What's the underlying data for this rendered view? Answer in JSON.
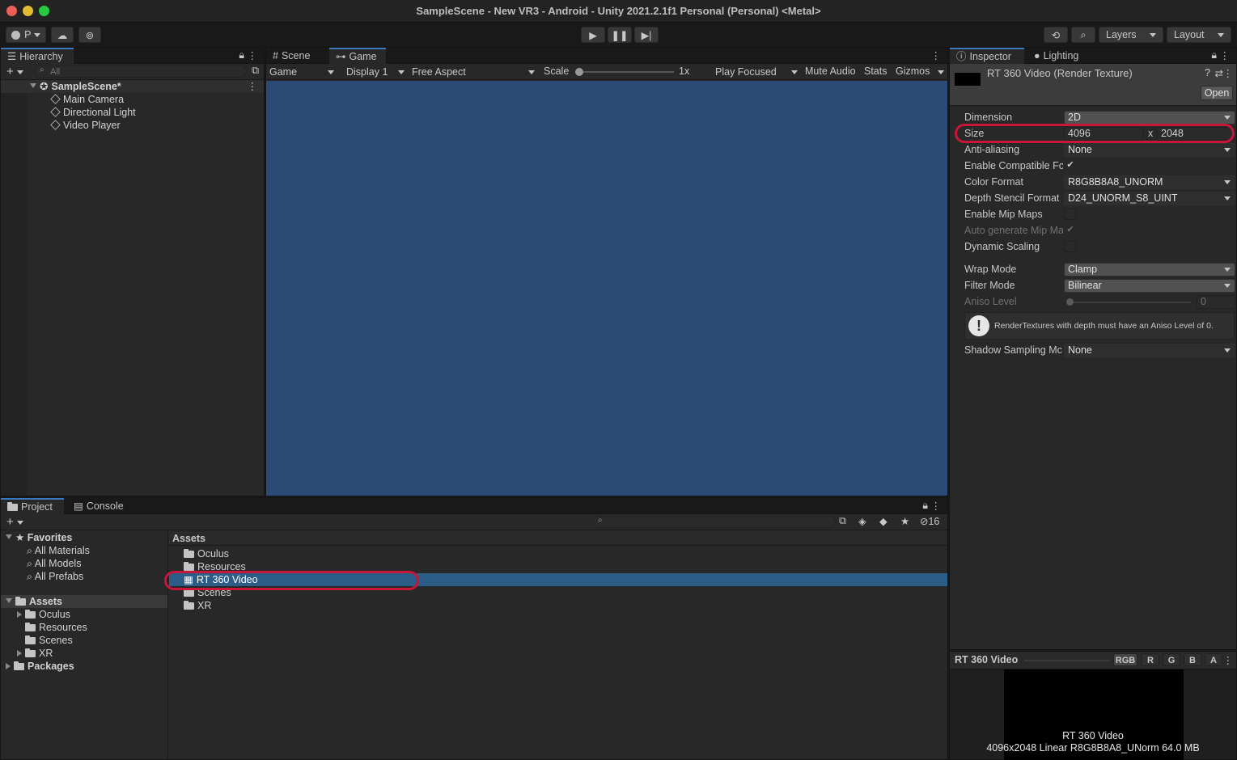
{
  "window": {
    "title": "SampleScene - New VR3 - Android - Unity 2021.2.1f1 Personal (Personal) <Metal>"
  },
  "toolbar": {
    "account": "P",
    "layers": "Layers",
    "layout": "Layout"
  },
  "hierarchy": {
    "tab": "Hierarchy",
    "search_placeholder": "All",
    "scene": "SampleScene*",
    "items": [
      "Main Camera",
      "Directional Light",
      "Video Player"
    ]
  },
  "game": {
    "tabs": [
      "Scene",
      "Game"
    ],
    "display_mode": "Game",
    "display": "Display 1",
    "aspect": "Free Aspect",
    "scale_label": "Scale",
    "scale_value": "1x",
    "play_focused": "Play Focused",
    "mute": "Mute Audio",
    "stats": "Stats",
    "gizmos": "Gizmos",
    "bg_color": "#2b4a76"
  },
  "inspector": {
    "tabs": [
      "Inspector",
      "Lighting"
    ],
    "asset_title": "RT 360 Video (Render Texture)",
    "open_button": "Open",
    "fields": {
      "dimension": {
        "label": "Dimension",
        "value": "2D"
      },
      "size": {
        "label": "Size",
        "width": "4096",
        "x": "x",
        "height": "2048"
      },
      "anti_aliasing": {
        "label": "Anti-aliasing",
        "value": "None"
      },
      "compatible": {
        "label": "Enable Compatible Fc",
        "checked": true
      },
      "color_format": {
        "label": "Color Format",
        "value": "R8G8B8A8_UNORM"
      },
      "depth_format": {
        "label": "Depth Stencil Format",
        "value": "D24_UNORM_S8_UINT"
      },
      "mip_maps": {
        "label": "Enable Mip Maps",
        "checked": false
      },
      "auto_mip": {
        "label": "Auto generate Mip Ma",
        "checked": true
      },
      "dynamic_scaling": {
        "label": "Dynamic Scaling",
        "checked": false
      },
      "wrap_mode": {
        "label": "Wrap Mode",
        "value": "Clamp"
      },
      "filter_mode": {
        "label": "Filter Mode",
        "value": "Bilinear"
      },
      "aniso": {
        "label": "Aniso Level",
        "value": "0"
      },
      "warning": "RenderTextures with depth must have an Aniso Level of 0.",
      "shadow": {
        "label": "Shadow Sampling Mc",
        "value": "None"
      }
    },
    "preview": {
      "title": "RT 360 Video",
      "channels": [
        "RGB",
        "R",
        "G",
        "B",
        "A"
      ],
      "caption": "RT 360 Video",
      "info": "4096x2048 Linear  R8G8B8A8_UNorm  64.0 MB"
    }
  },
  "project": {
    "tabs": [
      "Project",
      "Console"
    ],
    "hidden_count": "16",
    "favorites_label": "Favorites",
    "favorites": [
      "All Materials",
      "All Models",
      "All Prefabs"
    ],
    "assets_label": "Assets",
    "asset_tree": [
      "Oculus",
      "Resources",
      "Scenes",
      "XR"
    ],
    "packages_label": "Packages",
    "breadcrumb": "Assets",
    "files": [
      "Oculus",
      "Resources",
      "RT 360 Video",
      "Scenes",
      "XR"
    ]
  },
  "colors": {
    "accent": "#3a79bb",
    "selection": "#2c5d87",
    "highlight_ring": "#c8163a"
  }
}
